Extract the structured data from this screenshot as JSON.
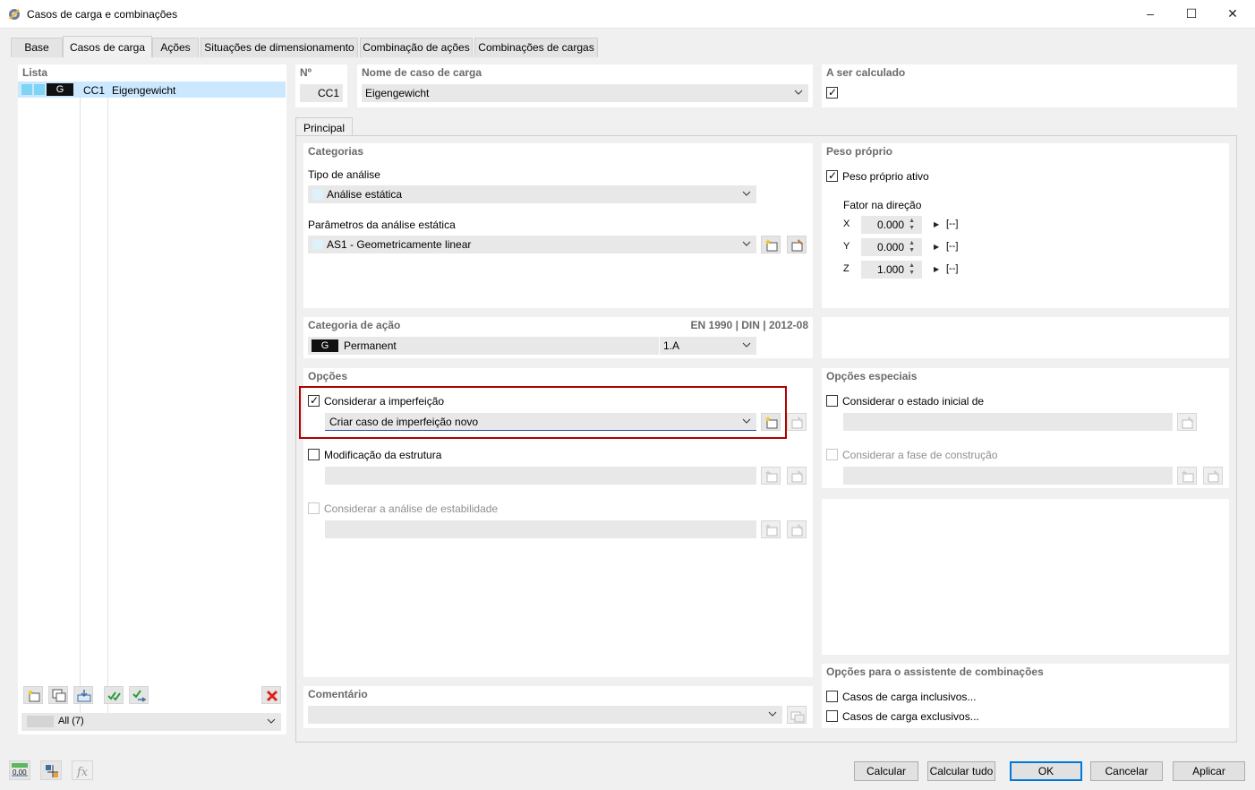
{
  "window": {
    "title": "Casos de carga e combinações",
    "minimize_icon": "minimize-icon",
    "maximize_icon": "maximize-icon",
    "close_icon": "close-icon"
  },
  "tabs": [
    {
      "label": "Base"
    },
    {
      "label": "Casos de carga"
    },
    {
      "label": "Ações"
    },
    {
      "label": "Situações de dimensionamento"
    },
    {
      "label": "Combinação de ações"
    },
    {
      "label": "Combinações de cargas"
    }
  ],
  "list": {
    "header": "Lista",
    "items": [
      {
        "badge": "G",
        "code": "CC1",
        "name": "Eigengewicht"
      }
    ],
    "filter": "All (7)"
  },
  "top": {
    "no_label": "Nº",
    "no_value": "CC1",
    "name_label": "Nome de caso de carga",
    "name_value": "Eigengewicht",
    "calc_label": "A ser calculado"
  },
  "subtab": "Principal",
  "categorias": {
    "header": "Categorias",
    "tipo_label": "Tipo de análise",
    "tipo_value": "Análise estática",
    "param_label": "Parâmetros da análise estática",
    "param_value": "AS1 - Geometricamente linear"
  },
  "peso": {
    "header": "Peso próprio",
    "ativo_label": "Peso próprio ativo",
    "fator_label": "Fator na direção",
    "rows": [
      {
        "axis": "X",
        "value": "0.000",
        "unit": "[--]"
      },
      {
        "axis": "Y",
        "value": "0.000",
        "unit": "[--]"
      },
      {
        "axis": "Z",
        "value": "1.000",
        "unit": "[--]"
      }
    ]
  },
  "acao": {
    "header": "Categoria de ação",
    "norm": "EN 1990 | DIN | 2012-08",
    "badge": "G",
    "value": "Permanent",
    "code": "1.A"
  },
  "opcoes": {
    "header": "Opções",
    "imperf_label": "Considerar a imperfeição",
    "imperf_value": "Criar caso de imperfeição novo",
    "mod_label": "Modificação da estrutura",
    "estab_label": "Considerar a análise de estabilidade"
  },
  "especiais": {
    "header": "Opções especiais",
    "estado_label": "Considerar o estado inicial de",
    "fase_label": "Considerar a fase de construção"
  },
  "assistente": {
    "header": "Opções para o assistente de combinações",
    "inclusivos": "Casos de carga inclusivos...",
    "exclusivos": "Casos de carga exclusivos..."
  },
  "comentario": {
    "header": "Comentário"
  },
  "buttons": {
    "calcular": "Calcular",
    "calcular_tudo": "Calcular tudo",
    "ok": "OK",
    "cancelar": "Cancelar",
    "aplicar": "Aplicar"
  },
  "bottom_icons": {
    "units": "0,00"
  },
  "colors": {
    "accent": "#0078d7",
    "highlight_box": "#c00000",
    "selected_row": "#cce8ff",
    "swatch": "#7fd3f5"
  }
}
